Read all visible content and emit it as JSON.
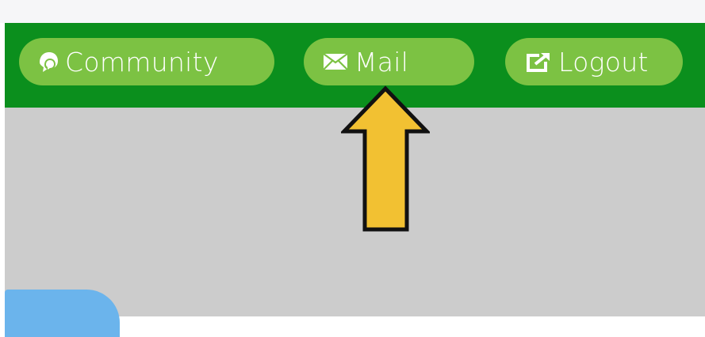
{
  "nav": {
    "community_label": "Community",
    "mail_label": "Mail",
    "logout_label": "Logout"
  },
  "icons": {
    "community": "chat-bubbles-icon",
    "mail": "envelope-icon",
    "logout": "external-link-icon"
  },
  "colors": {
    "navbar_bg": "#0b8f1d",
    "pill_bg": "#7cc243",
    "pill_text": "#ffffff",
    "content_bg": "#cccccc",
    "arrow_fill": "#f2c132",
    "arrow_stroke": "#111111",
    "tab_bg": "#6bb4ec"
  },
  "annotation": {
    "type": "arrow-pointing-up",
    "target": "mail"
  }
}
